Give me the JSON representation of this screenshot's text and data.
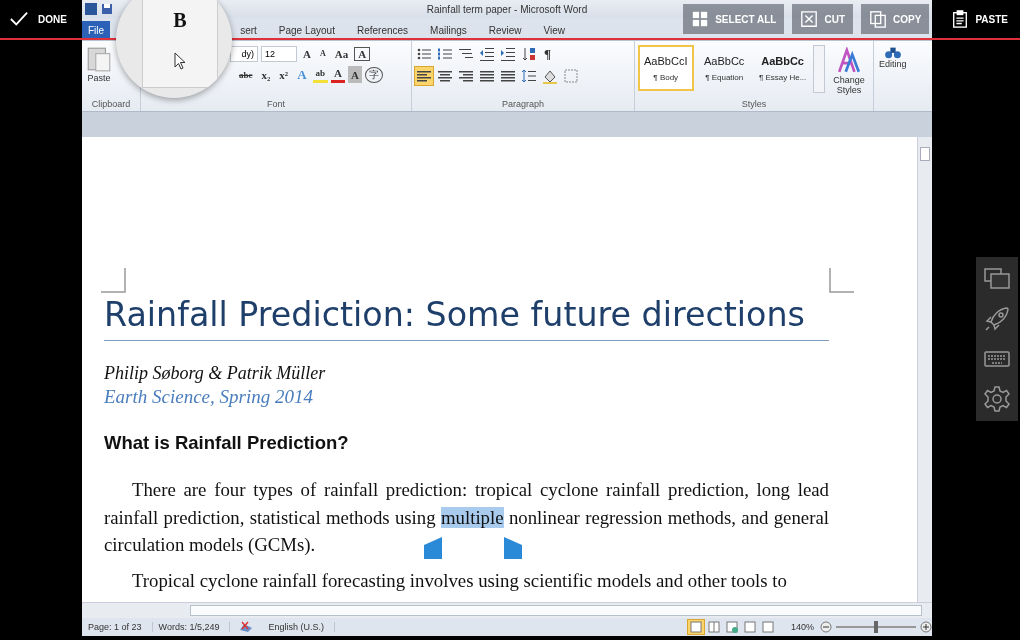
{
  "top_bar": {
    "done": "DONE",
    "actions": [
      {
        "kind": "select-all",
        "label": "SELECT ALL"
      },
      {
        "kind": "cut",
        "label": "CUT"
      },
      {
        "kind": "copy",
        "label": "COPY"
      },
      {
        "kind": "paste",
        "label": "PASTE"
      }
    ]
  },
  "window": {
    "title": "Rainfall term paper - Microsoft Word"
  },
  "tabs": [
    {
      "label": "File",
      "kind": "file",
      "selected": false
    },
    {
      "label": "sert",
      "kind": "tab",
      "selected": false
    },
    {
      "label": "Page Layout",
      "kind": "tab",
      "selected": false
    },
    {
      "label": "References",
      "kind": "tab",
      "selected": false
    },
    {
      "label": "Mailings",
      "kind": "tab",
      "selected": false
    },
    {
      "label": "Review",
      "kind": "tab",
      "selected": false
    },
    {
      "label": "View",
      "kind": "tab",
      "selected": false
    }
  ],
  "magnifier": {
    "glyph": "B"
  },
  "ribbon": {
    "clipboard": {
      "paste": "Paste",
      "label": "Clipboard"
    },
    "font": {
      "name": "dy)",
      "size": "12",
      "label": "Font",
      "row1": [
        {
          "glyph": "A",
          "kind": "grow"
        },
        {
          "glyph": "A",
          "kind": "shrink"
        },
        {
          "glyph": "Aa",
          "kind": "case"
        },
        {
          "glyph": "A",
          "kind": "boxed"
        }
      ],
      "row2": [
        {
          "glyph": "abc",
          "kind": "strike"
        },
        {
          "glyph": "x₂",
          "kind": "plain"
        },
        {
          "glyph": "x²",
          "kind": "plain"
        },
        {
          "glyph": "A",
          "kind": "effect"
        },
        {
          "glyph": "ab",
          "kind": "highlight"
        },
        {
          "glyph": "A",
          "kind": "color"
        },
        {
          "glyph": "A",
          "kind": "shaded"
        },
        {
          "glyph": "字",
          "kind": "enclosed"
        }
      ]
    },
    "paragraph": {
      "label": "Paragraph",
      "row1": [
        {
          "kind": "bullets",
          "selected": false
        },
        {
          "kind": "numbering",
          "selected": false
        },
        {
          "kind": "multilevel",
          "selected": false
        },
        {
          "kind": "outdent",
          "selected": false
        },
        {
          "kind": "indent",
          "selected": false
        },
        {
          "kind": "sort",
          "selected": false
        },
        {
          "kind": "pilcrow",
          "glyph": "¶",
          "selected": false
        }
      ],
      "row2": [
        {
          "kind": "align-left",
          "selected": true
        },
        {
          "kind": "align-center",
          "selected": false
        },
        {
          "kind": "align-right",
          "selected": false
        },
        {
          "kind": "justify",
          "selected": false
        },
        {
          "kind": "distributed",
          "selected": false
        },
        {
          "kind": "spacing",
          "selected": false
        },
        {
          "kind": "shading",
          "selected": false
        },
        {
          "kind": "borders",
          "selected": false
        }
      ]
    },
    "styles": {
      "label": "Styles",
      "change": "Change Styles",
      "items": [
        {
          "sample": "AaBbCcI",
          "name": "¶ Body",
          "kind": "normal",
          "selected": true
        },
        {
          "sample": "AaBbCc",
          "name": "¶ Equation",
          "kind": "normal",
          "selected": false
        },
        {
          "sample": "AaBbCc",
          "name": "¶ Essay He...",
          "kind": "bold",
          "selected": false
        }
      ]
    },
    "editing": {
      "label": "Editing"
    }
  },
  "document": {
    "title": "Rainfall Prediction: Some future directions",
    "authors": "Philip Søborg & Patrik Müller",
    "affiliation": "Earth Science, Spring 2014",
    "heading": "What is Rainfall Prediction?",
    "paragraphs": [
      {
        "parts": [
          {
            "text": "There are four types of rainfall prediction: tropical cyclone rainfall prediction, long lead rainfall prediction, statistical methods using ",
            "selected": false
          },
          {
            "text": "multiple",
            "selected": true
          },
          {
            "text": " nonlinear regression methods, and general circulation models (GCMs).",
            "selected": false
          }
        ]
      },
      {
        "parts": [
          {
            "text": "Tropical cyclone rainfall forecasting involves using scientific models and other tools to",
            "selected": false
          }
        ]
      }
    ]
  },
  "status_bar": {
    "page": "Page: 1 of 23",
    "words": "Words: 1/5,249",
    "language": "English (U.S.)",
    "zoom": "140%",
    "views": [
      {
        "kind": "print",
        "selected": true
      },
      {
        "kind": "reading",
        "selected": false
      },
      {
        "kind": "web",
        "selected": false
      },
      {
        "kind": "outline",
        "selected": false
      },
      {
        "kind": "draft",
        "selected": false
      }
    ],
    "zoom_slider": {
      "level": 0.5
    }
  },
  "side_panel": [
    {
      "kind": "windows"
    },
    {
      "kind": "rocket"
    },
    {
      "kind": "keyboard"
    },
    {
      "kind": "settings"
    }
  ]
}
